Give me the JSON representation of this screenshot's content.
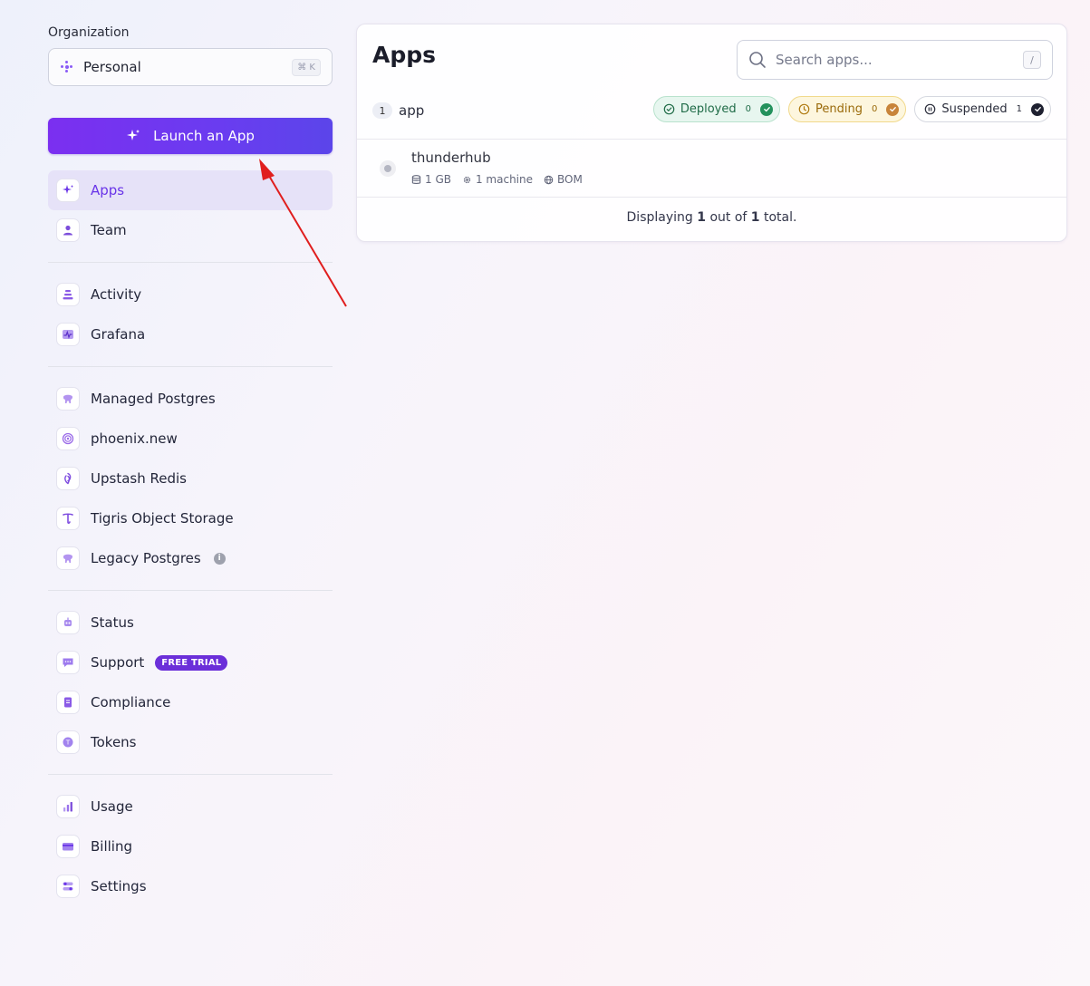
{
  "sidebar": {
    "org_label": "Organization",
    "org_name": "Personal",
    "org_shortcut": "⌘ K",
    "launch_label": "Launch an App",
    "groups": [
      [
        {
          "label": "Apps",
          "icon": "sparkle-icon",
          "active": true
        },
        {
          "label": "Team",
          "icon": "user-icon"
        }
      ],
      [
        {
          "label": "Activity",
          "icon": "activity-icon"
        },
        {
          "label": "Grafana",
          "icon": "grafana-icon"
        }
      ],
      [
        {
          "label": "Managed Postgres",
          "icon": "elephant-icon"
        },
        {
          "label": "phoenix.new",
          "icon": "spiral-icon"
        },
        {
          "label": "Upstash Redis",
          "icon": "upstash-icon"
        },
        {
          "label": "Tigris Object Storage",
          "icon": "tigris-icon"
        },
        {
          "label": "Legacy Postgres",
          "icon": "elephant-icon",
          "info": "i"
        }
      ],
      [
        {
          "label": "Status",
          "icon": "status-icon"
        },
        {
          "label": "Support",
          "icon": "chat-icon",
          "badge": "FREE TRIAL"
        },
        {
          "label": "Compliance",
          "icon": "document-icon"
        },
        {
          "label": "Tokens",
          "icon": "token-icon"
        }
      ],
      [
        {
          "label": "Usage",
          "icon": "bar-chart-icon"
        },
        {
          "label": "Billing",
          "icon": "credit-card-icon"
        },
        {
          "label": "Settings",
          "icon": "settings-icon"
        }
      ]
    ]
  },
  "main": {
    "title": "Apps",
    "search_placeholder": "Search apps...",
    "search_shortcut": "/",
    "count": "1",
    "count_label": "app",
    "filters": [
      {
        "label": "Deployed",
        "count": "0",
        "kind": "deployed"
      },
      {
        "label": "Pending",
        "count": "0",
        "kind": "pending"
      },
      {
        "label": "Suspended",
        "count": "1",
        "kind": "suspended"
      }
    ],
    "apps": [
      {
        "name": "thunderhub",
        "memory": "1 GB",
        "machines": "1 machine",
        "region": "BOM"
      }
    ],
    "footer": {
      "prefix": "Displaying ",
      "shown": "1",
      "middle": " out of ",
      "total": "1",
      "suffix": " total."
    }
  },
  "colors": {
    "accent": "#6a35e8",
    "annotation_arrow": "#e01e1e"
  }
}
